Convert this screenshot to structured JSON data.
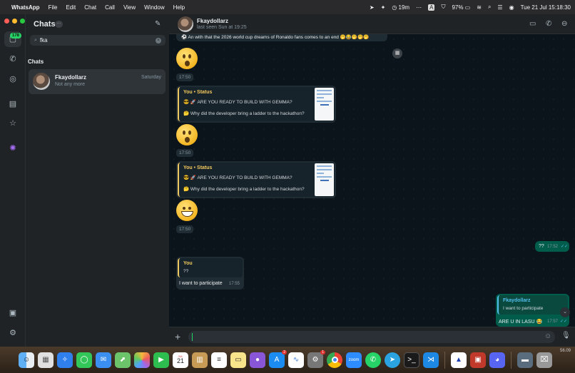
{
  "menubar": {
    "app": "WhatsApp",
    "menus": [
      "File",
      "Edit",
      "Chat",
      "Call",
      "View",
      "Window",
      "Help"
    ],
    "timer": "19m",
    "battery": "97%",
    "clock": "Tue 21 Jul  15:18:30"
  },
  "rail": {
    "unread_badge": "178",
    "icons": [
      "chats-icon",
      "calls-icon",
      "status-icon",
      "archive-icon",
      "starred-icon",
      "meta-ai-icon",
      "media-icon",
      "settings-icon"
    ]
  },
  "chatlist": {
    "title": "Chats",
    "more": "···",
    "search_value": "fka",
    "section": "Chats",
    "row": {
      "name": "Fkaydollarz",
      "preview": "Not any more",
      "date": "Saturday"
    }
  },
  "header": {
    "name": "Fkaydollarz",
    "last_seen": "last seen Sun at 19:25"
  },
  "messages": {
    "top_line": "⚽ An with that the 2026 world cup dreams of Ronaldo fans comes to an end 🤭😂🤭🤭🤭",
    "t1": "17:50",
    "status1": {
      "title": "You • Status",
      "line1": "😎 🚀 ARE YOU READY TO BUILD WITH GEMMA?",
      "line2": "🤔 Why did the developer bring a ladder to the hackathon?"
    },
    "t2": "17:50",
    "status2": {
      "title": "You • Status",
      "line1": "😎 🚀 ARE YOU READY TO BUILD WITH GEMMA?",
      "line2": "🤔 Why did the developer bring a ladder to the hackathon?"
    },
    "t3": "17:50",
    "out1": {
      "text": "??",
      "time": "17:52"
    },
    "reply_in": {
      "quote_title": "You",
      "quote_text": "??",
      "text": "I want to participate",
      "time": "17:55"
    },
    "reply_out": {
      "quote_title": "Fkaydollarz",
      "quote_text": "I want to participate",
      "text": "ARE U IN LASU 😂",
      "time": "17:57"
    }
  },
  "composer": {
    "placeholder": ""
  },
  "dock": {
    "apps": [
      "finder-icon",
      "launchpad-icon",
      "safari-icon",
      "messages-icon",
      "mail-icon",
      "maps-icon",
      "photos-icon",
      "facetime-icon",
      "calendar-icon",
      "notes-icon",
      "reminders-icon",
      "stickies-icon",
      "github-icon",
      "appstore-icon",
      "freeform-icon",
      "settings-icon",
      "chrome-icon",
      "zoom-icon",
      "whatsapp-icon",
      "telegram-icon",
      "terminal-icon",
      "vscode-icon",
      "acrobat-icon",
      "winrar-icon",
      "discord-icon",
      "downloads-icon",
      "trash-icon"
    ],
    "calendar_day": "21",
    "calendar_month": "JUL",
    "appstore_badge": "2",
    "settings_badge": "1",
    "zoom_label": "zoom",
    "watermark": "56.09"
  }
}
